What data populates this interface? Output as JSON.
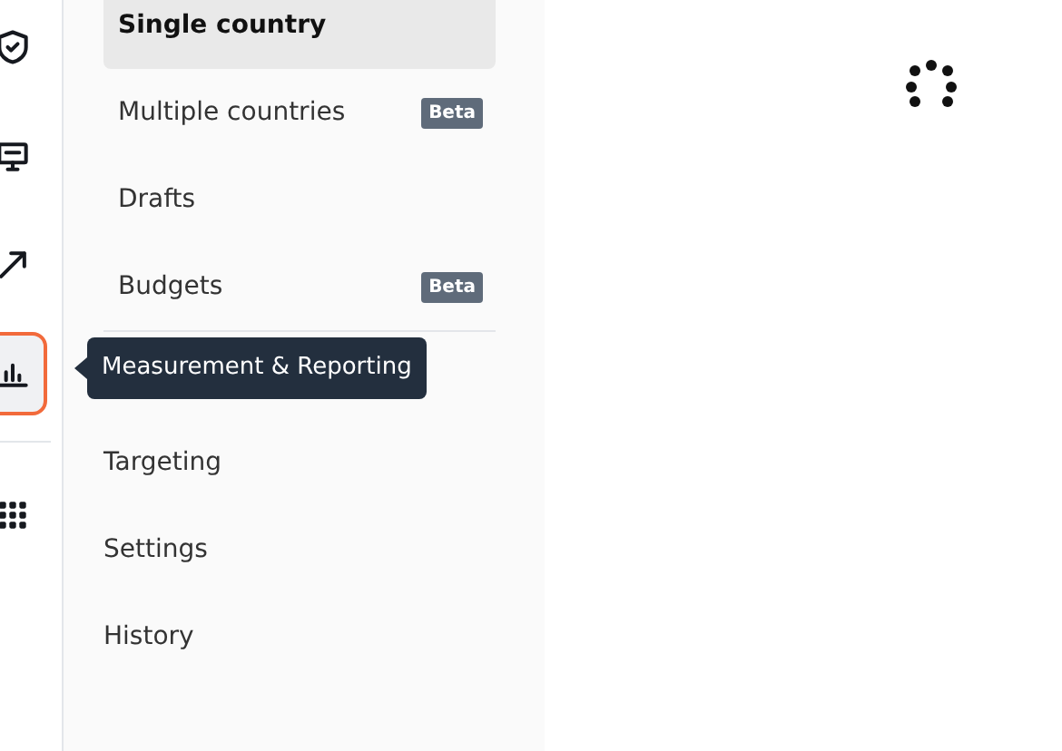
{
  "rail": {
    "items": [
      {
        "kind": "shield",
        "selected": false
      },
      {
        "kind": "monitor",
        "selected": false
      },
      {
        "kind": "arrow",
        "selected": false
      },
      {
        "kind": "chart",
        "selected": true
      },
      {
        "kind": "divider"
      },
      {
        "kind": "grid",
        "selected": false
      }
    ]
  },
  "sidebar": {
    "items": [
      {
        "label": "Single country",
        "selected": true
      },
      {
        "label": "Multiple countries",
        "selected": false,
        "badge": "Beta"
      },
      {
        "label": "Drafts",
        "selected": false
      },
      {
        "label": "Budgets",
        "selected": false,
        "badge": "Beta"
      }
    ],
    "sections": [
      {
        "label": "Targeting"
      },
      {
        "label": "Settings"
      },
      {
        "label": "History"
      }
    ]
  },
  "tooltip": {
    "text": "Measurement & Reporting"
  },
  "main": {
    "loading": true
  }
}
